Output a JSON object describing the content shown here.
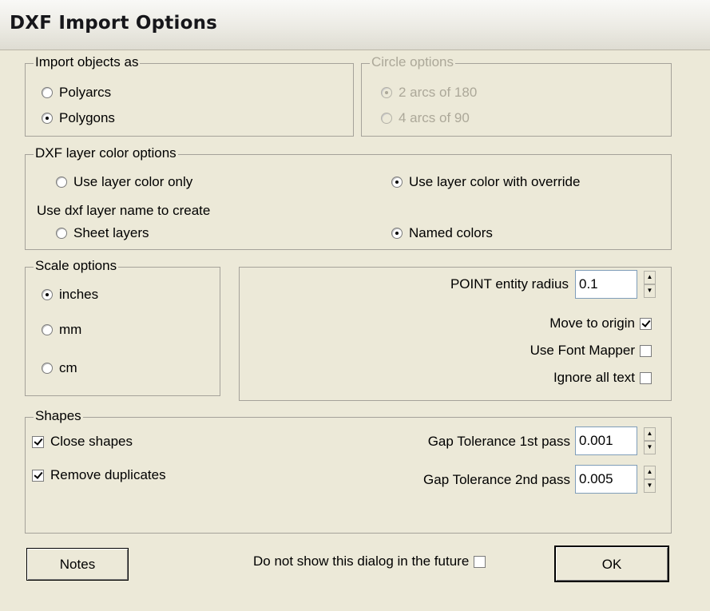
{
  "window": {
    "title": "DXF Import Options"
  },
  "import_objects": {
    "legend": "Import objects as",
    "options": [
      {
        "label": "Polyarcs",
        "selected": false
      },
      {
        "label": "Polygons",
        "selected": true
      }
    ]
  },
  "circle_options": {
    "legend": "Circle options",
    "enabled": false,
    "options": [
      {
        "label": "2 arcs of 180",
        "selected": true
      },
      {
        "label": "4 arcs of 90",
        "selected": false
      }
    ]
  },
  "layer_color": {
    "legend": "DXF layer color options",
    "use_layer_color_only": {
      "label": "Use layer color only",
      "selected": false
    },
    "use_layer_color_override": {
      "label": "Use layer color with override",
      "selected": true
    },
    "create_label": "Use dxf layer name to create",
    "sheet_layers": {
      "label": "Sheet layers",
      "selected": false
    },
    "named_colors": {
      "label": "Named colors",
      "selected": true
    }
  },
  "scale": {
    "legend": "Scale options",
    "options": [
      {
        "label": "inches",
        "selected": true
      },
      {
        "label": "mm",
        "selected": false
      },
      {
        "label": "cm",
        "selected": false
      }
    ]
  },
  "point_panel": {
    "point_radius_label": "POINT entity radius",
    "point_radius_value": "0.1",
    "move_to_origin": {
      "label": "Move to origin",
      "checked": true
    },
    "use_font_mapper": {
      "label": "Use Font Mapper",
      "checked": false
    },
    "ignore_all_text": {
      "label": "Ignore all text",
      "checked": false
    }
  },
  "shapes": {
    "legend": "Shapes",
    "close_shapes": {
      "label": "Close shapes",
      "checked": true
    },
    "remove_duplicates": {
      "label": "Remove duplicates",
      "checked": true
    },
    "gap1_label": "Gap Tolerance 1st pass",
    "gap1_value": "0.001",
    "gap2_label": "Gap Tolerance 2nd pass",
    "gap2_value": "0.005"
  },
  "footer": {
    "notes_label": "Notes",
    "dont_show_label": "Do not show this dialog in the future",
    "dont_show_checked": false,
    "ok_label": "OK"
  }
}
